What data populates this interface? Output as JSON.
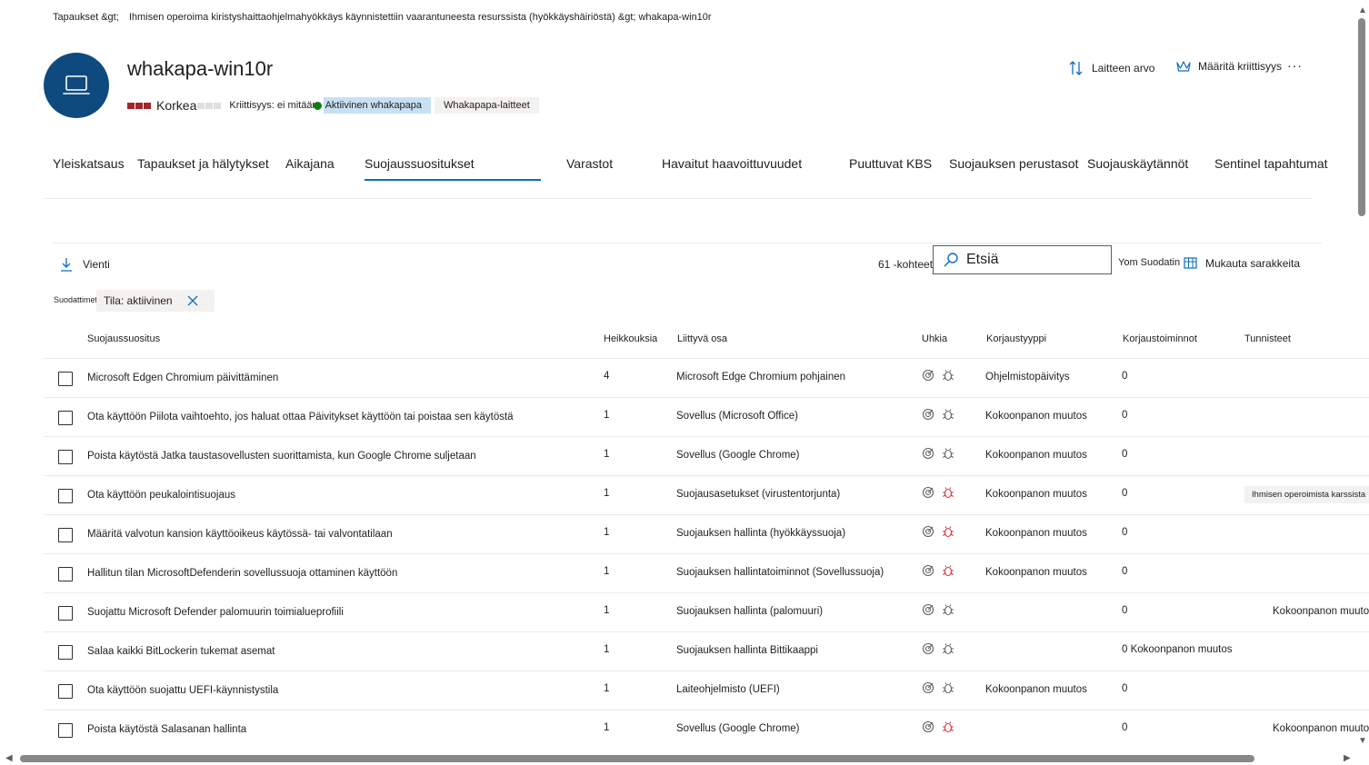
{
  "breadcrumb": {
    "root": "Tapaukset &gt;",
    "path": "Ihmisen operoima kiristyshaittaohjelmahyökkäys käynnistettiin vaarantuneesta resurssista (hyökkäyshäiriöstä) &gt; whakapa-win10r"
  },
  "device": {
    "name": "whakapa-win10r",
    "severity": "Korkea",
    "criticality": "Kriittisyys: ei mitään",
    "tag_active": "Aktiivinen whakapapa",
    "tag_group": "Whakapapa-laitteet",
    "severity_color": "#a4262c"
  },
  "actions": {
    "device_value": "Laitteen arvo",
    "set_criticality": "Määritä kriittisyys",
    "more": "···"
  },
  "tabs": [
    {
      "label": "Yleiskatsaus"
    },
    {
      "label": "Tapaukset ja hälytykset"
    },
    {
      "label": "Aikajana"
    },
    {
      "label": "Suojaussuositukset"
    },
    {
      "label": "Varastot"
    },
    {
      "label": "Havaitut haavoittuvuudet"
    },
    {
      "label": "Puuttuvat KBS"
    },
    {
      "label": "Suojauksen perustasot"
    },
    {
      "label": "Suojauskäytännöt"
    },
    {
      "label": "Sentinel tapahtumat"
    }
  ],
  "toolbar": {
    "export": "Vienti",
    "count": "61 -kohteet",
    "search_placeholder": "Etsiä",
    "filter": "Yom Suodatin",
    "customize": "Mukauta sarakkeita"
  },
  "filters": {
    "label": "Suodattimet:",
    "chip": "Tila: aktiivinen"
  },
  "table": {
    "headers": [
      "Suojaussuositus",
      "Heikkouksia",
      "Liittyvä osa",
      "Uhkia",
      "Korjaustyyppi",
      "Korjaustoiminnot",
      "Tunnisteet"
    ],
    "rows": [
      {
        "rec": "Microsoft Edgen Chromium päivittäminen",
        "weak": "4",
        "comp": "Microsoft Edge Chromium pohjainen",
        "bug_red": false,
        "type": "Ohjelmistopäivitys",
        "acts": "0",
        "tag": ""
      },
      {
        "rec": "Ota käyttöön Piilota vaihtoehto, jos haluat ottaa Päivitykset käyttöön tai poistaa sen käytöstä",
        "weak": "1",
        "comp": "Sovellus (Microsoft Office)",
        "bug_red": false,
        "type": "Kokoonpanon muutos",
        "acts": "0",
        "tag": ""
      },
      {
        "rec": "Poista käytöstä Jatka taustasovellusten suorittamista, kun Google Chrome suljetaan",
        "weak": "1",
        "comp": "Sovellus (Google Chrome)",
        "bug_red": false,
        "type": "Kokoonpanon muutos",
        "acts": "0",
        "tag": ""
      },
      {
        "rec": "Ota käyttöön peukalointisuojaus",
        "weak": "1",
        "comp": "Suojausasetukset (virustentorjunta)",
        "bug_red": true,
        "type": "Kokoonpanon muutos",
        "acts": "0",
        "tag": "Ihmisen operoimista karssista"
      },
      {
        "rec": "Määritä valvotun kansion käyttöoikeus käytössä- tai valvontatilaan",
        "weak": "1",
        "comp": "Suojauksen hallinta (hyökkäyssuoja)",
        "bug_red": true,
        "type": "Kokoonpanon muutos",
        "acts": "0",
        "tag": ""
      },
      {
        "rec": "Hallitun tilan MicrosoftDefenderin sovellussuoja ottaminen käyttöön",
        "weak": "1",
        "comp": "Suojauksen hallintatoiminnot (Sovellussuoja)",
        "bug_red": true,
        "type": "Kokoonpanon muutos",
        "acts": "0",
        "tag": ""
      },
      {
        "rec": "Suojattu Microsoft Defender palomuurin toimialueprofiili",
        "weak": "1",
        "comp": "Suojauksen hallinta (palomuuri)",
        "bug_red": false,
        "type": "",
        "acts": "0",
        "tag": "",
        "extra": "Kokoonpanon muutos"
      },
      {
        "rec": "Salaa kaikki BitLockerin tukemat asemat",
        "weak": "1",
        "comp": "Suojauksen hallinta Bittikaappi",
        "bug_red": false,
        "type": "",
        "acts": "0 Kokoonpanon muutos",
        "tag": ""
      },
      {
        "rec": "Ota käyttöön suojattu UEFI-käynnistystila",
        "weak": "1",
        "comp": "Laiteohjelmisto (UEFI)",
        "bug_red": false,
        "type": "Kokoonpanon muutos",
        "acts": "0",
        "tag": ""
      },
      {
        "rec": "Poista käytöstä Salasanan hallinta",
        "weak": "1",
        "comp": "Sovellus (Google Chrome)",
        "bug_red": true,
        "type": "",
        "acts": "0",
        "tag": "",
        "extra": "Kokoonpanon muutos"
      }
    ]
  },
  "colors": {
    "accent": "#0f6cbd",
    "avatar": "#0f4a7e",
    "threat_red": "#d13438",
    "icon_gray": "#605e5c"
  }
}
